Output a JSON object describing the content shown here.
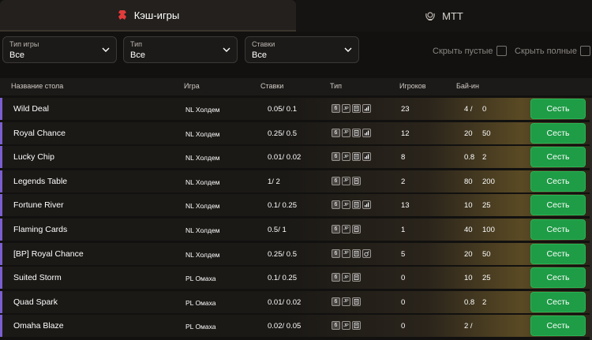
{
  "tabs": [
    {
      "label": "Кэш-игры",
      "icon": "cash-games-icon",
      "active": true
    },
    {
      "label": "МТТ",
      "icon": "trophy-wreath-icon",
      "active": false
    }
  ],
  "filters": [
    {
      "label": "Тип игры",
      "value": "Все"
    },
    {
      "label": "Тип",
      "value": "Все"
    },
    {
      "label": "Ставки",
      "value": "Все"
    }
  ],
  "toggles": {
    "hide_empty": "Скрыть пустые",
    "hide_full": "Скрыть полные"
  },
  "columns": {
    "name": "Название стола",
    "game": "Игра",
    "stakes": "Ставки",
    "type": "Тип",
    "players": "Игроков",
    "buyin": "Бай-ин"
  },
  "sit_label": "Сесть",
  "colors": {
    "accent_left": "#7b5ecf",
    "sit_button": "#1e9c46",
    "tab_icon": "#e23b3b"
  },
  "rows": [
    {
      "name": "Wild Deal",
      "game": "NL Холдем",
      "stakes": "0.05/   0.1",
      "icons": [
        "6",
        "JP",
        "doc",
        "bars"
      ],
      "players": "23",
      "buyin": "4 /",
      "buyin2": "0"
    },
    {
      "name": "Royal Chance",
      "game": "NL Холдем",
      "stakes": "0.25/   0.5",
      "icons": [
        "6",
        "JP",
        "doc",
        "bars"
      ],
      "players": "12",
      "buyin": "20",
      "buyin2": "50"
    },
    {
      "name": "Lucky Chip",
      "game": "NL Холдем",
      "stakes": "0.01/   0.02",
      "icons": [
        "6",
        "JP",
        "doc",
        "bars"
      ],
      "players": "8",
      "buyin": "0.8",
      "buyin2": "2"
    },
    {
      "name": "Legends Table",
      "game": "NL Холдем",
      "stakes": "1/   2",
      "icons": [
        "6",
        "JP",
        "doc"
      ],
      "players": "2",
      "buyin": "80",
      "buyin2": "200"
    },
    {
      "name": "Fortune River",
      "game": "NL Холдем",
      "stakes": "0.1/   0.25",
      "icons": [
        "6",
        "JP",
        "doc",
        "bars"
      ],
      "players": "13",
      "buyin": "10",
      "buyin2": "25"
    },
    {
      "name": "Flaming Cards",
      "game": "NL Холдем",
      "stakes": "0.5/   1",
      "icons": [
        "6",
        "JP",
        "doc"
      ],
      "players": "1",
      "buyin": "40",
      "buyin2": "100"
    },
    {
      "name": "[BP] Royal  Chance",
      "game": "NL Холдем",
      "stakes": "0.25/   0.5",
      "icons": [
        "6",
        "JP",
        "doc",
        "bomb"
      ],
      "players": "5",
      "buyin": "20",
      "buyin2": "50"
    },
    {
      "name": "Suited Storm",
      "game": "PL Омаха",
      "stakes": "0.1/   0.25",
      "icons": [
        "6",
        "JP",
        "doc"
      ],
      "players": "0",
      "buyin": "10",
      "buyin2": "25"
    },
    {
      "name": "Quad Spark",
      "game": "PL Омаха",
      "stakes": "0.01/   0.02",
      "icons": [
        "6",
        "JP",
        "doc"
      ],
      "players": "0",
      "buyin": "0.8",
      "buyin2": "2"
    },
    {
      "name": "Omaha Blaze",
      "game": "PL Омаха",
      "stakes": "0.02/   0.05",
      "icons": [
        "6",
        "JP",
        "doc"
      ],
      "players": "0",
      "buyin": "2 /",
      "buyin2": ""
    }
  ]
}
